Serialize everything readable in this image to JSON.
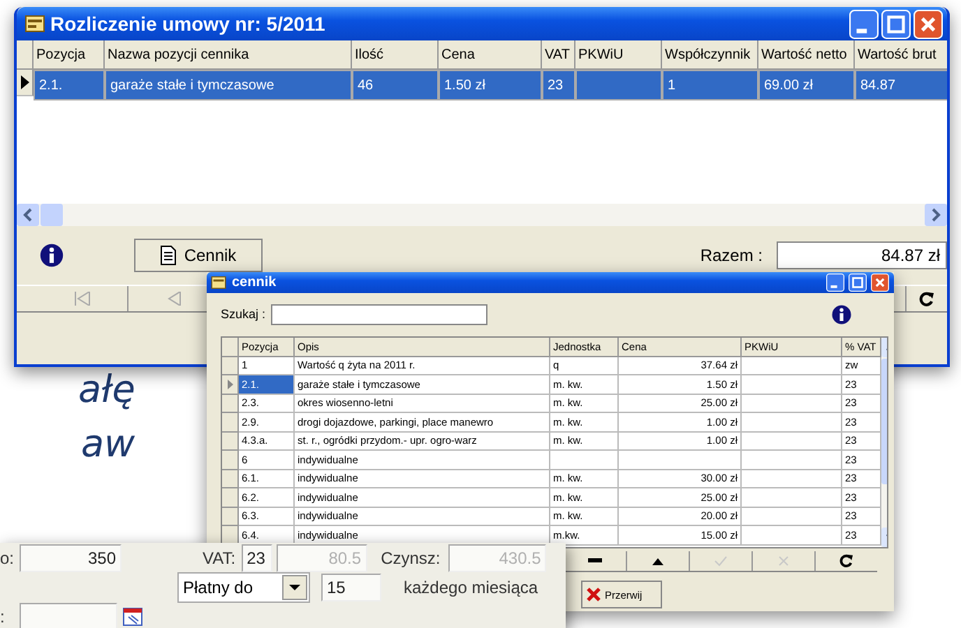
{
  "background_text": [
    "ałę",
    "aw"
  ],
  "main_window": {
    "title": "Rozliczenie umowy nr: 5/2011",
    "table": {
      "columns": [
        "Pozycja",
        "Nazwa pozycji cennika",
        "Ilość",
        "Cena",
        "VAT",
        "PKWiU",
        "Współczynnik",
        "Wartość netto",
        "Wartość brut"
      ],
      "rows": [
        {
          "selected": true,
          "cells": [
            "2.1.",
            "garaże stałe i tymczasowe",
            "46",
            "1.50 zł",
            "23",
            "",
            "1",
            "69.00 zł",
            "84.87"
          ]
        }
      ]
    },
    "cennik_button": "Cennik",
    "total_label": "Razem :",
    "total_value": "84.87 zł"
  },
  "cennik_window": {
    "title": "cennik",
    "search_label": "Szukaj :",
    "table": {
      "columns": [
        "Pozycja",
        "Opis",
        "Jednostka",
        "Cena",
        "PKWiU",
        "% VAT"
      ],
      "rows": [
        {
          "selected": false,
          "cells": [
            "1",
            "Wartość q żyta na 2011 r.",
            "q",
            "37.64 zł",
            "",
            "zw"
          ]
        },
        {
          "selected": true,
          "cells": [
            "2.1.",
            "garaże stałe i tymczasowe",
            "m. kw.",
            "1.50 zł",
            "",
            "23"
          ]
        },
        {
          "selected": false,
          "cells": [
            "2.3.",
            "okres wiosenno-letni",
            "m. kw.",
            "25.00 zł",
            "",
            "23"
          ]
        },
        {
          "selected": false,
          "cells": [
            "2.9.",
            "drogi dojazdowe, parkingi, place manewro",
            "m. kw.",
            "1.00 zł",
            "",
            "23"
          ]
        },
        {
          "selected": false,
          "cells": [
            "4.3.a.",
            "st. r., ogródki przydom.- upr. ogro-warz",
            "m. kw.",
            "1.00 zł",
            "",
            "23"
          ]
        },
        {
          "selected": false,
          "cells": [
            "6",
            "indywidualne",
            "",
            "",
            "",
            "23"
          ]
        },
        {
          "selected": false,
          "cells": [
            "6.1.",
            "indywidualne",
            "m. kw.",
            "30.00 zł",
            "",
            "23"
          ]
        },
        {
          "selected": false,
          "cells": [
            "6.2.",
            "indywidualne",
            "m. kw.",
            "25.00 zł",
            "",
            "23"
          ]
        },
        {
          "selected": false,
          "cells": [
            "6.3.",
            "indywidualne",
            "m. kw.",
            "20.00 zł",
            "",
            "23"
          ]
        },
        {
          "selected": false,
          "cells": [
            "6.4.",
            "indywidualne",
            "m.kw.",
            "15.00 zł",
            "",
            "23"
          ]
        }
      ]
    },
    "cancel_button": "Przerwij"
  },
  "form_panel": {
    "amount_label": "o:",
    "amount": {
      "value": "350",
      "disabled": false
    },
    "vat_label": "VAT:",
    "vat_rate": {
      "value": "23",
      "disabled": false
    },
    "vat_amount": {
      "value": "80.5",
      "disabled": true
    },
    "rent_label": "Czynsz:",
    "rent": {
      "value": "430.5",
      "disabled": true
    },
    "payment_select": "Płatny do",
    "day": {
      "value": "15",
      "disabled": false
    },
    "day_suffix": "każdego miesiąca",
    "date_label": ":"
  }
}
